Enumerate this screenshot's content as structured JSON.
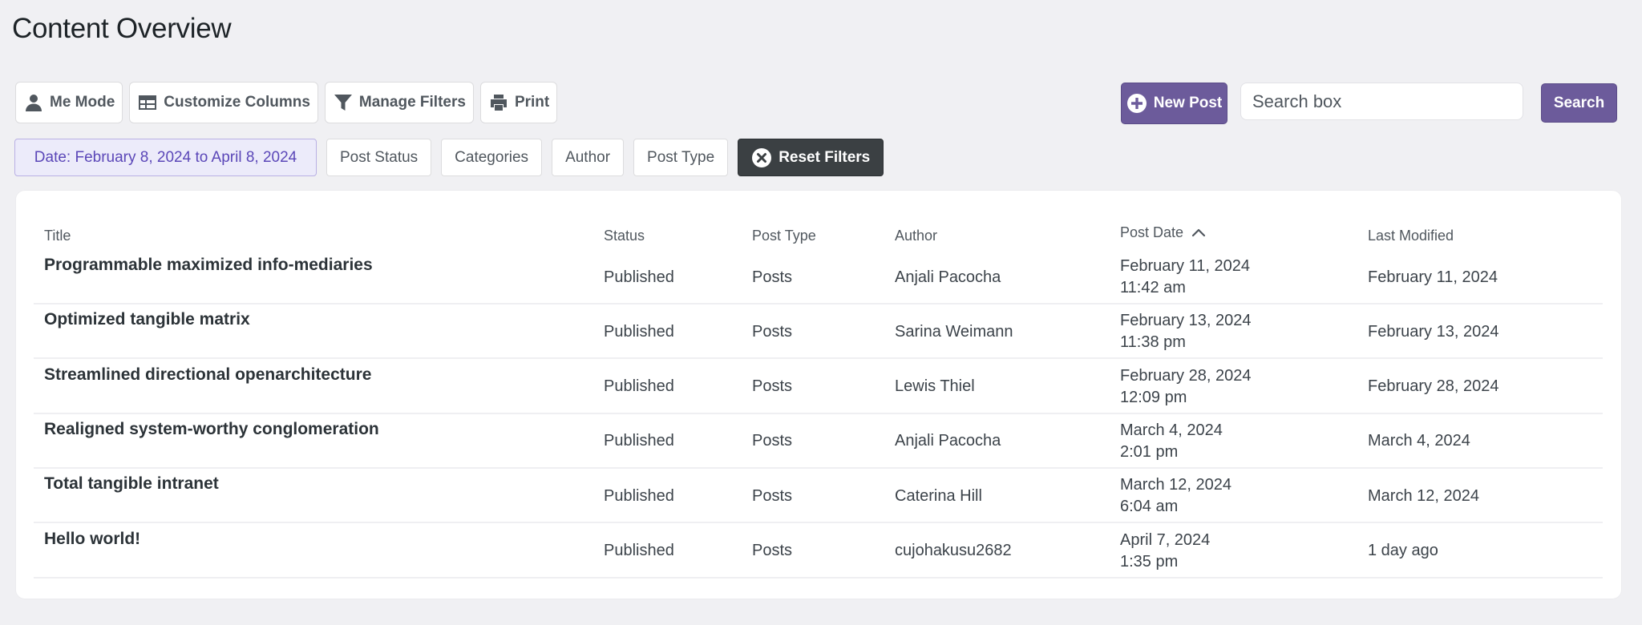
{
  "page": {
    "title": "Content Overview"
  },
  "toolbar": {
    "buttons": [
      {
        "label": "Me Mode",
        "icon": "user-icon"
      },
      {
        "label": "Customize Columns",
        "icon": "table-icon"
      },
      {
        "label": "Manage Filters",
        "icon": "filter-icon"
      },
      {
        "label": "Print",
        "icon": "print-icon"
      }
    ],
    "new_post_label": "New Post",
    "search_placeholder": "Search box",
    "search_label": "Search"
  },
  "filters": {
    "date": "Date: February 8, 2024 to April 8, 2024",
    "post_status": "Post Status",
    "categories": "Categories",
    "author": "Author",
    "post_type": "Post Type",
    "reset": "Reset Filters"
  },
  "table": {
    "headers": {
      "title": "Title",
      "status": "Status",
      "post_type": "Post Type",
      "author": "Author",
      "post_date": "Post Date",
      "last_modified": "Last Modified"
    },
    "sort": {
      "column": "Post Date",
      "direction": "ascending"
    },
    "rows": [
      {
        "title": "Programmable maximized info-mediaries",
        "status": "Published",
        "post_type": "Posts",
        "author": "Anjali Pacocha",
        "date": "February 11, 2024",
        "time": "11:42 am",
        "modified": "February 11, 2024"
      },
      {
        "title": "Optimized tangible matrix",
        "status": "Published",
        "post_type": "Posts",
        "author": "Sarina Weimann",
        "date": "February 13, 2024",
        "time": "11:38 pm",
        "modified": "February 13, 2024"
      },
      {
        "title": "Streamlined directional openarchitecture",
        "status": "Published",
        "post_type": "Posts",
        "author": "Lewis Thiel",
        "date": "February 28, 2024",
        "time": "12:09 pm",
        "modified": "February 28, 2024"
      },
      {
        "title": "Realigned system-worthy conglomeration",
        "status": "Published",
        "post_type": "Posts",
        "author": "Anjali Pacocha",
        "date": "March 4, 2024",
        "time": "2:01 pm",
        "modified": "March 4, 2024"
      },
      {
        "title": "Total tangible intranet",
        "status": "Published",
        "post_type": "Posts",
        "author": "Caterina Hill",
        "date": "March 12, 2024",
        "time": "6:04 am",
        "modified": "March 12, 2024"
      },
      {
        "title": "Hello world!",
        "status": "Published",
        "post_type": "Posts",
        "author": "cujohakusu2682",
        "date": "April 7, 2024",
        "time": "1:35 pm",
        "modified": "1 day ago"
      }
    ]
  },
  "colors": {
    "accent": "#6c5b9b",
    "reset_bg": "#3b4043",
    "date_filter_bg": "#ecebfa"
  }
}
